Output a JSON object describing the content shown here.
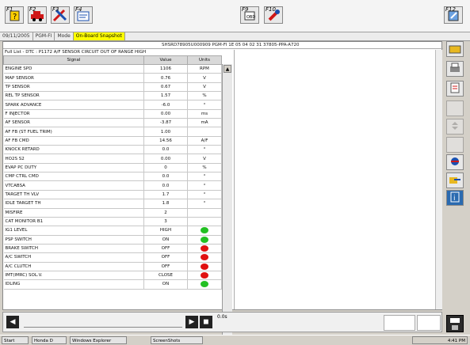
{
  "toolbar": {
    "left_buttons": [
      {
        "key": "F1",
        "icon": "help-icon"
      },
      {
        "key": "F2",
        "icon": "car-icon"
      },
      {
        "key": "F3",
        "icon": "tools-icon"
      },
      {
        "key": "F4",
        "icon": "settings-icon"
      }
    ],
    "mid_buttons": [
      {
        "key": "F9",
        "icon": "obd-icon"
      },
      {
        "key": "F10",
        "icon": "flame-icon"
      }
    ],
    "right_button": {
      "key": "F12",
      "icon": "exit-icon"
    }
  },
  "status": {
    "date": "09/11/2005",
    "system": "PGM-FI",
    "mode_label": "Mode",
    "mode_value": "On-Board Snapshot"
  },
  "vehicle_info": "SHSRD78905U000909  PGM-FI  1E 05 04 02 31  37805-PPA-A720",
  "list_title": "Full List - DTC : P1172     A/F SENSOR CIRCUIT OUT OF RANGE HIGH",
  "columns": {
    "signal": "Signal",
    "value": "Value",
    "units": "Units"
  },
  "rows": [
    {
      "signal": "ENGINE SPD",
      "value": "1106",
      "units": "RPM",
      "ind": ""
    },
    {
      "signal": "MAP SENSOR",
      "value": "0.76",
      "units": "V",
      "ind": ""
    },
    {
      "signal": "TP SENSOR",
      "value": "0.67",
      "units": "V",
      "ind": ""
    },
    {
      "signal": "REL TP SENSOR",
      "value": "1.57",
      "units": "%",
      "ind": ""
    },
    {
      "signal": "SPARK ADVANCE",
      "value": "-6.0",
      "units": "°",
      "ind": ""
    },
    {
      "signal": "F INJECTOR",
      "value": "0.00",
      "units": "ms",
      "ind": ""
    },
    {
      "signal": "AF SENSOR",
      "value": "-3.87",
      "units": "mA",
      "ind": ""
    },
    {
      "signal": "AF FB (ST FUEL TRIM)",
      "value": "1.00",
      "units": "",
      "ind": ""
    },
    {
      "signal": "AF FB CMD",
      "value": "14.56",
      "units": "A/F",
      "ind": ""
    },
    {
      "signal": "KNOCK RETARD",
      "value": "0.0",
      "units": "°",
      "ind": ""
    },
    {
      "signal": "HO2S S2",
      "value": "0.00",
      "units": "V",
      "ind": ""
    },
    {
      "signal": "EVAP PC DUTY",
      "value": "0",
      "units": "%",
      "ind": ""
    },
    {
      "signal": "CMP CTRL CMD",
      "value": "0.0",
      "units": "°",
      "ind": ""
    },
    {
      "signal": "VTCABSA",
      "value": "0.0",
      "units": "°",
      "ind": ""
    },
    {
      "signal": "TARGET TH VLV",
      "value": "1.7",
      "units": "°",
      "ind": ""
    },
    {
      "signal": "IDLE TARGET TH",
      "value": "1.8",
      "units": "°",
      "ind": ""
    },
    {
      "signal": "MISFIRE",
      "value": "2",
      "units": "",
      "ind": ""
    },
    {
      "signal": "CAT MONITOR B1",
      "value": "3",
      "units": "",
      "ind": ""
    },
    {
      "signal": "IG1 LEVEL",
      "value": "HIGH",
      "units": "",
      "ind": "green"
    },
    {
      "signal": "PSP SWITCH",
      "value": "ON",
      "units": "",
      "ind": "green"
    },
    {
      "signal": "BRAKE SWITCH",
      "value": "OFF",
      "units": "",
      "ind": "red"
    },
    {
      "signal": "A/C SWITCH",
      "value": "OFF",
      "units": "",
      "ind": "red"
    },
    {
      "signal": "A/C CLUTCH",
      "value": "OFF",
      "units": "",
      "ind": "red"
    },
    {
      "signal": "IMT(IMRC) SOL.V.",
      "value": "CLOSE",
      "units": "",
      "ind": "red"
    },
    {
      "signal": "IDLING",
      "value": "ON",
      "units": "",
      "ind": "green"
    }
  ],
  "colors": {
    "green": "#22c022",
    "red": "#e01010"
  },
  "sidebar_icons": [
    "folder-icon",
    "printer-icon",
    "data-list-icon",
    "blank-icon",
    "scroll-icon",
    "blank-icon",
    "snapshot-icon",
    "export-icon",
    "info-icon"
  ],
  "playback": {
    "time": "0.0s"
  },
  "taskbar": {
    "start": "Start",
    "tasks": [
      "Honda D",
      "Windows Explorer",
      "ScreenShots"
    ],
    "clock": "4:41 PM"
  }
}
